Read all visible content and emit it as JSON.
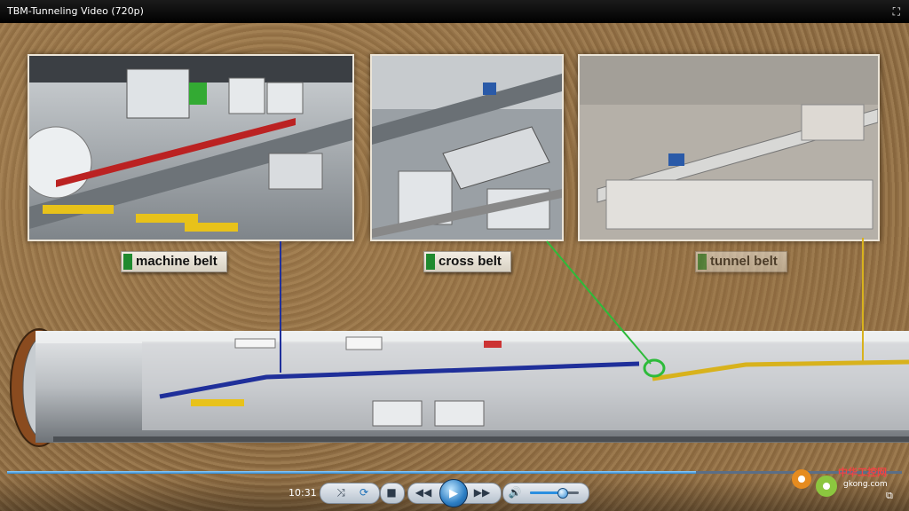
{
  "window": {
    "title": "TBM-Tunneling Video (720p)"
  },
  "labels": {
    "machine_belt": "machine belt",
    "cross_belt": "cross belt",
    "tunnel_belt": "tunnel belt"
  },
  "player": {
    "time": "10:31",
    "progress_fraction": 0.77,
    "volume_fraction": 0.65,
    "icons": {
      "fullscreen": "fullscreen-icon",
      "shuffle": "shuffle-icon",
      "repeat": "repeat-icon",
      "stop": "stop-icon",
      "previous": "rewind-icon",
      "play": "play-icon",
      "next": "fast-forward-icon",
      "volume": "speaker-icon",
      "expand": "expand-icon"
    }
  },
  "watermark": {
    "site_name": "中华工控网",
    "url": "gkong.com"
  },
  "colors": {
    "machine_belt": "#1f2f9a",
    "cross_belt": "#2dbb3a",
    "tunnel_belt": "#d8b21c",
    "accent": "#2b8fe0"
  }
}
